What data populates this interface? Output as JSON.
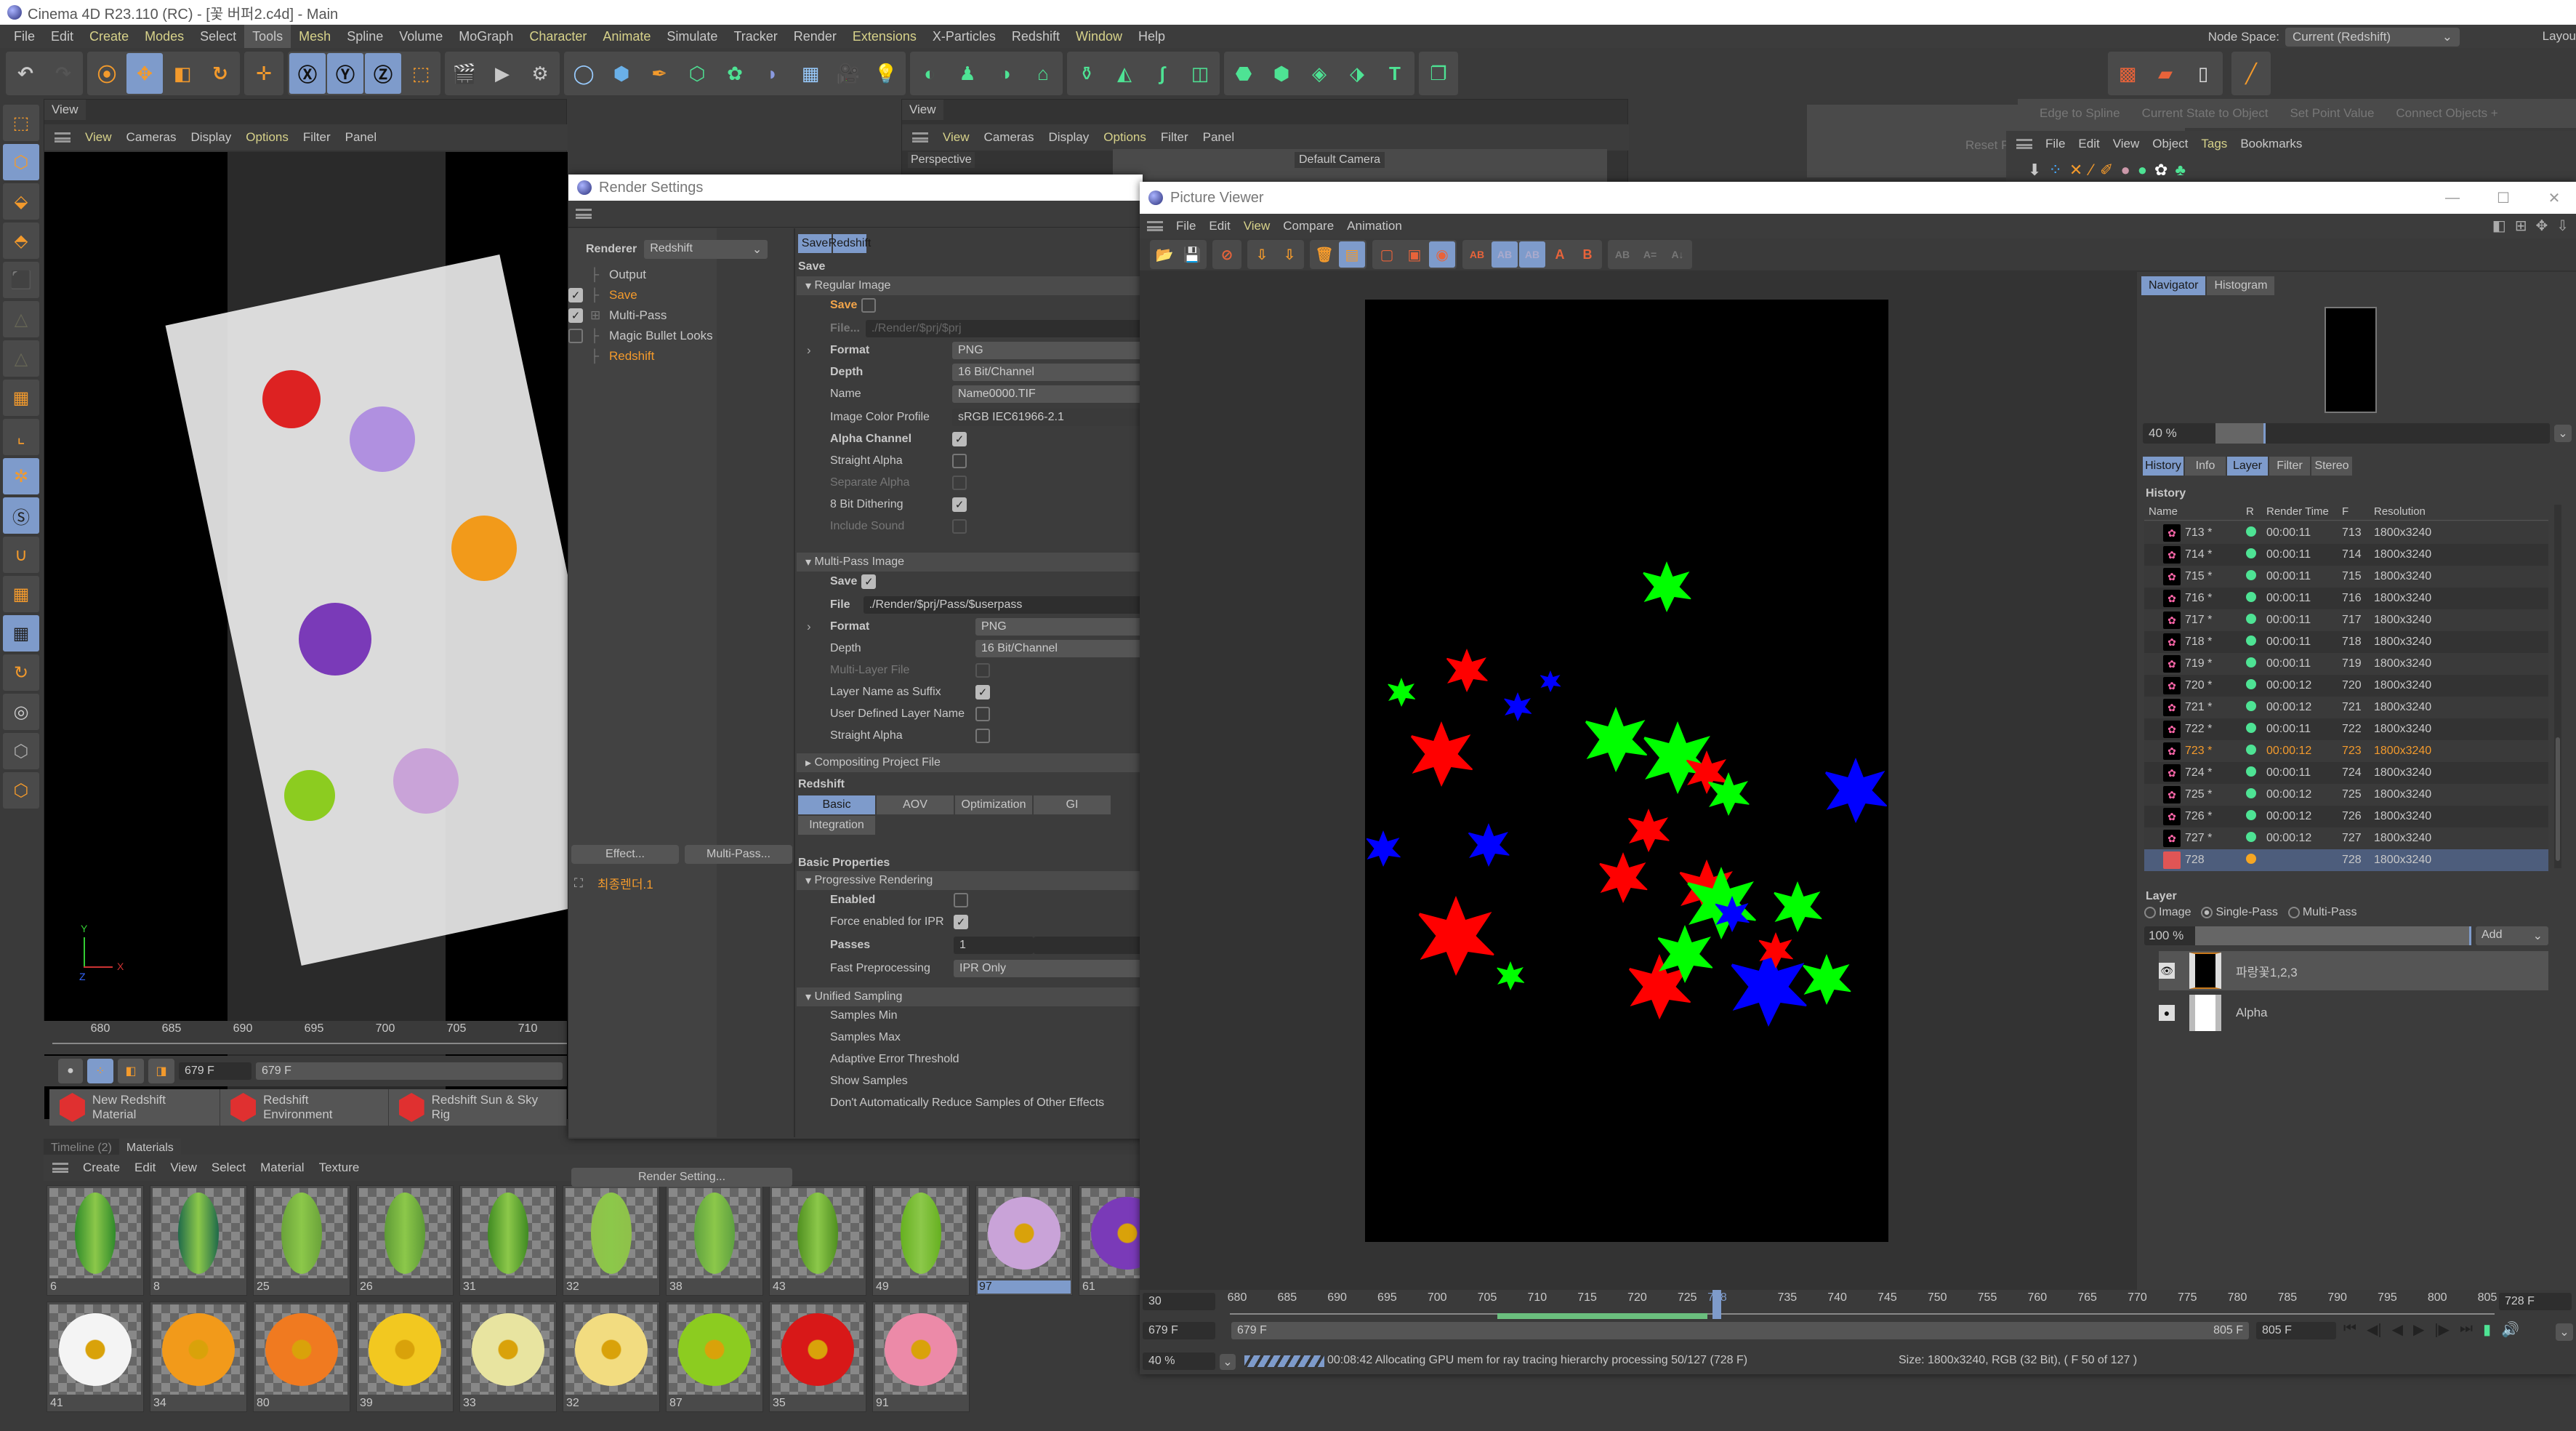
{
  "app": {
    "title": "Cinema 4D R23.110 (RC) - [꽃 버퍼2.c4d] - Main",
    "menu": [
      "File",
      "Edit",
      "Create",
      "Modes",
      "Select",
      "Tools",
      "Mesh",
      "Spline",
      "Volume",
      "MoGraph",
      "Character",
      "Animate",
      "Simulate",
      "Tracker",
      "Render",
      "Extensions",
      "X-Particles",
      "Redshift",
      "Window",
      "Help"
    ],
    "menu_highlighted": [
      "Create",
      "Modes",
      "Mesh",
      "Character",
      "Animate",
      "Extensions",
      "Window"
    ],
    "menu_active": "Tools",
    "node_space_label": "Node Space:",
    "node_space_value": "Current (Redshift)",
    "layout_label": "Layou"
  },
  "toolbar": {
    "icons": [
      "undo-icon",
      "redo-icon",
      "live-selection-icon",
      "move-icon",
      "scale-icon",
      "rotate-icon",
      "transform-icon",
      "x-axis-icon",
      "y-axis-icon",
      "z-axis-icon",
      "coordinate-system-icon",
      "render-view-icon",
      "render-picture-viewer-icon",
      "render-settings-icon",
      "null-icon",
      "cube-icon",
      "pen-icon",
      "subdivision-icon",
      "cloner-icon",
      "deformer-icon",
      "floor-icon",
      "camera-icon",
      "light-icon"
    ]
  },
  "command_bar": {
    "reset_psr": "Reset PSR",
    "items": [
      "Edge to Spline",
      "Current State to Object",
      "Set Point Value",
      "Connect Objects +"
    ]
  },
  "object_manager": {
    "menu": [
      "File",
      "Edit",
      "View",
      "Object",
      "Tags",
      "Bookmarks"
    ]
  },
  "viewport_left": {
    "tab": "View",
    "menu": [
      "View",
      "Cameras",
      "Display",
      "Options",
      "Filter",
      "Panel"
    ],
    "axis": {
      "x": "X",
      "y": "Y",
      "z": "Z"
    }
  },
  "viewport_right": {
    "tab": "View",
    "menu": [
      "View",
      "Cameras",
      "Display",
      "Options",
      "Filter",
      "Panel"
    ],
    "camera_label": "Perspective",
    "default_camera": "Default Camera"
  },
  "timeline_left": {
    "ticks": [
      "680",
      "685",
      "690",
      "695",
      "700",
      "705",
      "710"
    ],
    "current_frame": "679 F",
    "range_start": "679 F"
  },
  "redshift_bar": {
    "items": [
      "New Redshift Material",
      "Redshift Environment",
      "Redshift Sun & Sky Rig"
    ]
  },
  "materials": {
    "tabs": [
      "Timeline (2)",
      "Materials"
    ],
    "active_tab": "Materials",
    "menu": [
      "Create",
      "Edit",
      "View",
      "Select",
      "Material",
      "Texture"
    ],
    "row1": [
      {
        "name": "6",
        "kind": "leaf",
        "color": "#2f8a2a"
      },
      {
        "name": "8",
        "kind": "leaf",
        "color": "#1f6a4a"
      },
      {
        "name": "25",
        "kind": "leaf",
        "color": "#6aa23a"
      },
      {
        "name": "26",
        "kind": "leaf",
        "color": "#5e9a36"
      },
      {
        "name": "31",
        "kind": "leaf",
        "color": "#3f8a22"
      },
      {
        "name": "32",
        "kind": "leaf",
        "color": "#8fc04a"
      },
      {
        "name": "38",
        "kind": "leaf",
        "color": "#5ea040"
      },
      {
        "name": "43",
        "kind": "leaf",
        "color": "#4f8f20"
      },
      {
        "name": "49",
        "kind": "leaf",
        "color": "#66b020"
      },
      {
        "name": "97",
        "kind": "flower",
        "color": "#c9a3d8",
        "selected": true
      },
      {
        "name": "61",
        "kind": "flower",
        "color": "#7a3ab8"
      }
    ],
    "row2": [
      {
        "name": "41",
        "kind": "flower",
        "color": "#f4f4f4"
      },
      {
        "name": "34",
        "kind": "flower",
        "color": "#f29a1a"
      },
      {
        "name": "80",
        "kind": "flower",
        "color": "#f07a20"
      },
      {
        "name": "39",
        "kind": "flower",
        "color": "#f2c820"
      },
      {
        "name": "33",
        "kind": "flower",
        "color": "#e8e4a0"
      },
      {
        "name": "32",
        "kind": "flower",
        "color": "#f2dc80"
      },
      {
        "name": "87",
        "kind": "flower",
        "color": "#8ccc20"
      },
      {
        "name": "35",
        "kind": "flower",
        "color": "#d81818"
      },
      {
        "name": "91",
        "kind": "flower",
        "color": "#ec8aa8"
      }
    ]
  },
  "render_settings": {
    "title": "Render Settings",
    "renderer_label": "Renderer",
    "renderer_value": "Redshift",
    "tree": [
      {
        "label": "Output",
        "checked": null,
        "active": false
      },
      {
        "label": "Save",
        "checked": true,
        "active": true
      },
      {
        "label": "Multi-Pass",
        "checked": true,
        "active": false,
        "expandable": true
      },
      {
        "label": "Magic Bullet Looks",
        "checked": false,
        "active": false
      },
      {
        "label": "Redshift",
        "checked": null,
        "active": true
      }
    ],
    "effect_button": "Effect...",
    "multipass_button": "Multi-Pass...",
    "render_setting_item": "최종렌더.1",
    "render_setting_button": "Render Setting...",
    "top_tabs": [
      "Save",
      "Redshift"
    ],
    "save_header": "Save",
    "regular_image": {
      "header": "Regular Image",
      "save_label": "Save",
      "save_checked": false,
      "file_label": "File...",
      "file_value": "./Render/$prj/$prj",
      "format_label": "Format",
      "format_value": "PNG",
      "depth_label": "Depth",
      "depth_value": "16 Bit/Channel",
      "name_label": "Name",
      "name_value": "Name0000.TIF",
      "color_profile_label": "Image Color Profile",
      "color_profile_value": "sRGB IEC61966-2.1",
      "checks": [
        {
          "label": "Alpha Channel",
          "checked": true,
          "bold": true,
          "dim": false
        },
        {
          "label": "Straight Alpha",
          "checked": false,
          "bold": false,
          "dim": false
        },
        {
          "label": "Separate Alpha",
          "checked": false,
          "bold": false,
          "dim": true
        },
        {
          "label": "8 Bit Dithering",
          "checked": true,
          "bold": false,
          "dim": false
        },
        {
          "label": "Include Sound",
          "checked": false,
          "bold": false,
          "dim": true
        }
      ]
    },
    "multipass_image": {
      "header": "Multi-Pass Image",
      "save_label": "Save",
      "save_checked": true,
      "file_label": "File",
      "file_value": "./Render/$prj/Pass/$userpass",
      "format_label": "Format",
      "format_value": "PNG",
      "depth_label": "Depth",
      "depth_value": "16 Bit/Channel",
      "checks": [
        {
          "label": "Multi-Layer File",
          "checked": false,
          "dim": true
        },
        {
          "label": "Layer Name as Suffix",
          "checked": true,
          "dim": false
        },
        {
          "label": "User Defined Layer Name",
          "checked": false,
          "dim": false
        },
        {
          "label": "Straight Alpha",
          "checked": false,
          "dim": false
        }
      ]
    },
    "compositing_header": "Compositing Project File",
    "redshift_header": "Redshift",
    "redshift_tabs": [
      "Basic",
      "AOV",
      "Optimization",
      "GI",
      "Integration"
    ],
    "redshift_active_tab": "Basic",
    "basic_properties": "Basic Properties",
    "progressive": {
      "header": "Progressive Rendering",
      "enabled_label": "Enabled",
      "enabled": false,
      "force_ipr_label": "Force enabled for IPR",
      "force_ipr": true,
      "passes_label": "Passes",
      "passes_value": "1",
      "fast_pre_label": "Fast Preprocessing",
      "fast_pre_value": "IPR Only"
    },
    "unified": {
      "header": "Unified Sampling",
      "items": [
        "Samples Min",
        "Samples Max",
        "Adaptive Error Threshold",
        "Show Samples",
        "Don't Automatically Reduce Samples of Other Effects"
      ]
    }
  },
  "picture_viewer": {
    "title": "Picture Viewer",
    "menu": [
      "File",
      "Edit",
      "View",
      "Compare",
      "Animation"
    ],
    "menu_highlighted": "View",
    "panel_tabs": [
      "Navigator",
      "Histogram"
    ],
    "panel_active": "Navigator",
    "zoom_value": "40 %",
    "zoom_fraction": 0.15,
    "lower_tabs": [
      "History",
      "Info",
      "Layer",
      "Filter",
      "Stereo"
    ],
    "lower_active": [
      "History",
      "Layer"
    ],
    "history_title": "History",
    "history_columns": [
      "Name",
      "R",
      "Render Time",
      "F",
      "Resolution"
    ],
    "history": [
      {
        "name": "713 *",
        "status": "done",
        "time": "00:00:11",
        "frame": "713",
        "res": "1800x3240"
      },
      {
        "name": "714 *",
        "status": "done",
        "time": "00:00:11",
        "frame": "714",
        "res": "1800x3240"
      },
      {
        "name": "715 *",
        "status": "done",
        "time": "00:00:11",
        "frame": "715",
        "res": "1800x3240"
      },
      {
        "name": "716 *",
        "status": "done",
        "time": "00:00:11",
        "frame": "716",
        "res": "1800x3240"
      },
      {
        "name": "717 *",
        "status": "done",
        "time": "00:00:11",
        "frame": "717",
        "res": "1800x3240"
      },
      {
        "name": "718 *",
        "status": "done",
        "time": "00:00:11",
        "frame": "718",
        "res": "1800x3240"
      },
      {
        "name": "719 *",
        "status": "done",
        "time": "00:00:11",
        "frame": "719",
        "res": "1800x3240"
      },
      {
        "name": "720 *",
        "status": "done",
        "time": "00:00:12",
        "frame": "720",
        "res": "1800x3240"
      },
      {
        "name": "721 *",
        "status": "done",
        "time": "00:00:12",
        "frame": "721",
        "res": "1800x3240"
      },
      {
        "name": "722 *",
        "status": "done",
        "time": "00:00:11",
        "frame": "722",
        "res": "1800x3240"
      },
      {
        "name": "723 *",
        "status": "done",
        "time": "00:00:12",
        "frame": "723",
        "res": "1800x3240",
        "current": true
      },
      {
        "name": "724 *",
        "status": "done",
        "time": "00:00:11",
        "frame": "724",
        "res": "1800x3240"
      },
      {
        "name": "725 *",
        "status": "done",
        "time": "00:00:12",
        "frame": "725",
        "res": "1800x3240"
      },
      {
        "name": "726 *",
        "status": "done",
        "time": "00:00:12",
        "frame": "726",
        "res": "1800x3240"
      },
      {
        "name": "727 *",
        "status": "done",
        "time": "00:00:12",
        "frame": "727",
        "res": "1800x3240"
      },
      {
        "name": "728",
        "status": "rendering",
        "time": "",
        "frame": "728",
        "res": "1800x3240",
        "selected": true
      }
    ],
    "status_colors": {
      "done": "#4ee394",
      "rendering": "#f5a623"
    },
    "layer": {
      "title": "Layer",
      "modes": [
        "Image",
        "Single-Pass",
        "Multi-Pass"
      ],
      "mode_selected": "Single-Pass",
      "opacity": "100 %",
      "blend": "Add",
      "items": [
        "파랑꽃1,2,3",
        "Alpha"
      ]
    },
    "timeline": {
      "fps": "30",
      "ticks": [
        "680",
        "685",
        "690",
        "695",
        "700",
        "705",
        "710",
        "715",
        "720",
        "725",
        "728",
        "735",
        "740",
        "745",
        "750",
        "755",
        "760",
        "765",
        "770",
        "775",
        "780",
        "785",
        "790",
        "795",
        "800",
        "805"
      ],
      "current_frame": "728 F",
      "start_frame": "679 F",
      "range_start": "679 F",
      "range_end": "805 F",
      "end_frame": "805 F",
      "rendered_range": [
        706,
        727
      ]
    },
    "status": {
      "zoom": "40 %",
      "message": "00:08:42 Allocating GPU mem for ray tracing hierarchy processing 50/127 (728 F)",
      "info": "Size: 1800x3240, RGB (32 Bit),  ( F 50 of 127 )"
    }
  }
}
